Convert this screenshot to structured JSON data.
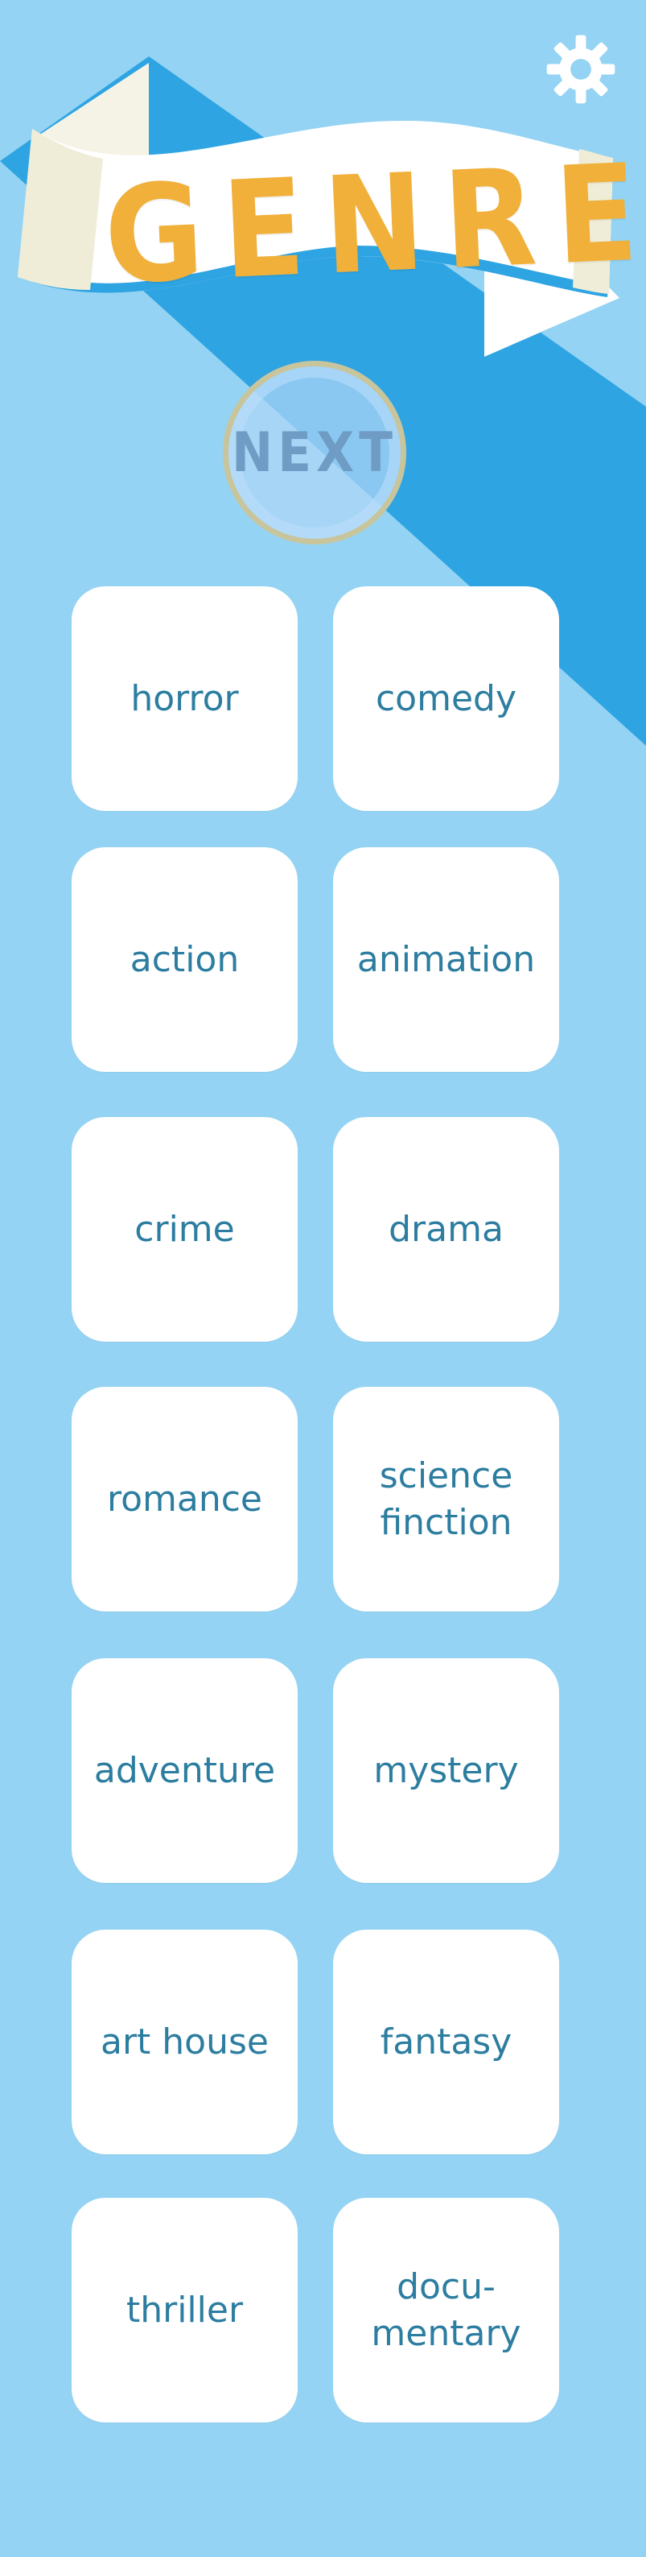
{
  "header": {
    "title": "GENRE",
    "settings_icon": "gear-icon"
  },
  "actions": {
    "next_label": "NEXT"
  },
  "genres": [
    "horror",
    "comedy",
    "action",
    "animation",
    "crime",
    "drama",
    "romance",
    "science\nfinction",
    "adventure",
    "mystery",
    "art house",
    "fantasy",
    "thriller",
    "docu-\nmentary"
  ],
  "colors": {
    "background": "#94d3f3",
    "accent_blue": "#2ea4e2",
    "ribbon_white": "#ffffff",
    "ribbon_cream": "#efedd8",
    "title_gold": "#f0b03a",
    "tile_text": "#2c7da0"
  }
}
